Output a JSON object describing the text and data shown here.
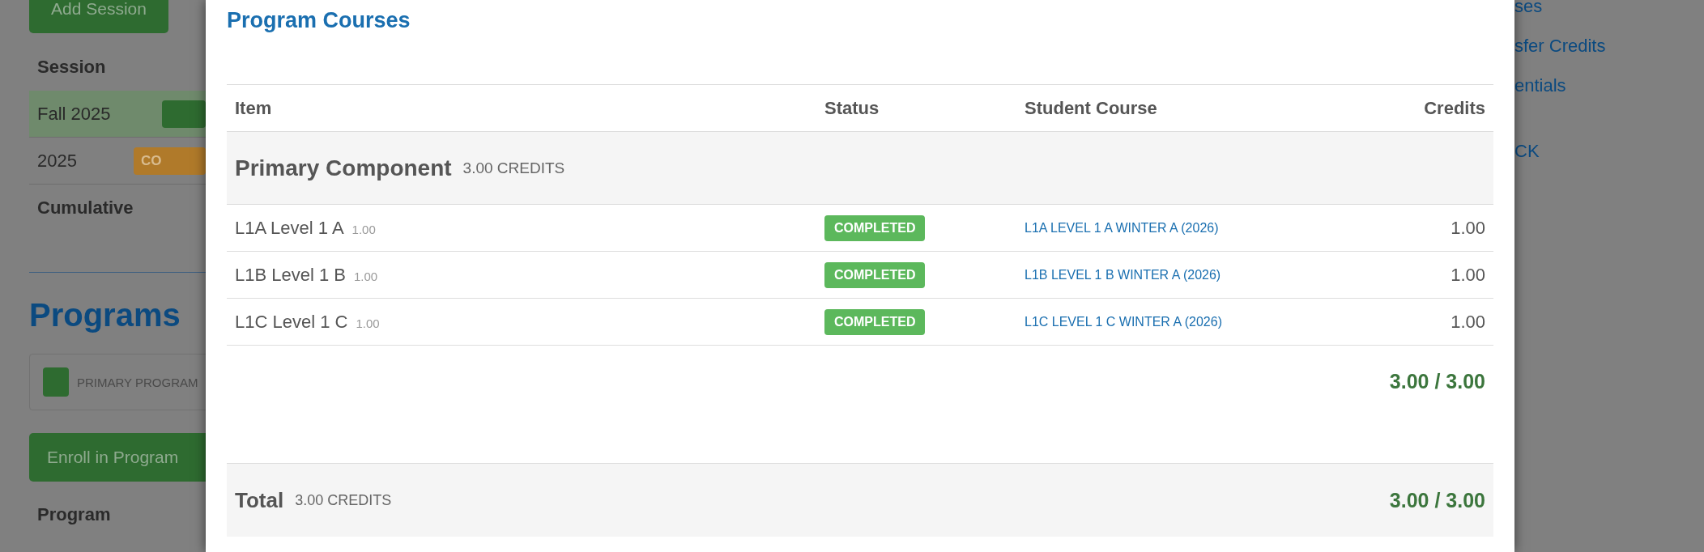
{
  "background_left": {
    "add_session_button": "Add Session",
    "session_header": "Session",
    "sessions": [
      {
        "name": "Fall 2025",
        "selected": true,
        "badge": {
          "color": "#2e6b30"
        }
      },
      {
        "name": "2025",
        "selected": false,
        "badge": {
          "color": "#b07a2a",
          "text": "CO"
        }
      }
    ],
    "cumulative_label": "Cumulative",
    "programs_heading": "Programs",
    "program_card": {
      "label": "PRIMARY PROGRAM"
    },
    "enroll_button": "Enroll in Program",
    "program_header": "Program"
  },
  "background_right": {
    "links": [
      "ses",
      "sfer Credits",
      "entials",
      "CK"
    ]
  },
  "modal": {
    "title": "Program Courses",
    "table": {
      "columns": [
        "Item",
        "Status",
        "Student Course",
        "Credits"
      ],
      "groups": [
        {
          "name": "Primary Component",
          "credits": "3.00 CREDITS",
          "subtotal": "3.00 / 3.00",
          "rows": [
            {
              "item": "L1A Level 1 A",
              "item_credits": "1.00",
              "status": {
                "kind": "success",
                "text": "COMPLETED"
              },
              "student_course": "L1A LEVEL 1 A WINTER A (2026)",
              "credits": "1.00"
            },
            {
              "item": "L1B Level 1 B",
              "item_credits": "1.00",
              "status": {
                "kind": "success",
                "text": "COMPLETED"
              },
              "student_course": "L1B LEVEL 1 B WINTER A (2026)",
              "credits": "1.00"
            },
            {
              "item": "L1C Level 1 C",
              "item_credits": "1.00",
              "status": {
                "kind": "success",
                "text": "COMPLETED"
              },
              "student_course": "L1C LEVEL 1 C WINTER A (2026)",
              "credits": "1.00"
            }
          ]
        }
      ],
      "total": {
        "label": "Total",
        "credits": "3.00 CREDITS",
        "value": "3.00 / 3.00"
      }
    }
  }
}
